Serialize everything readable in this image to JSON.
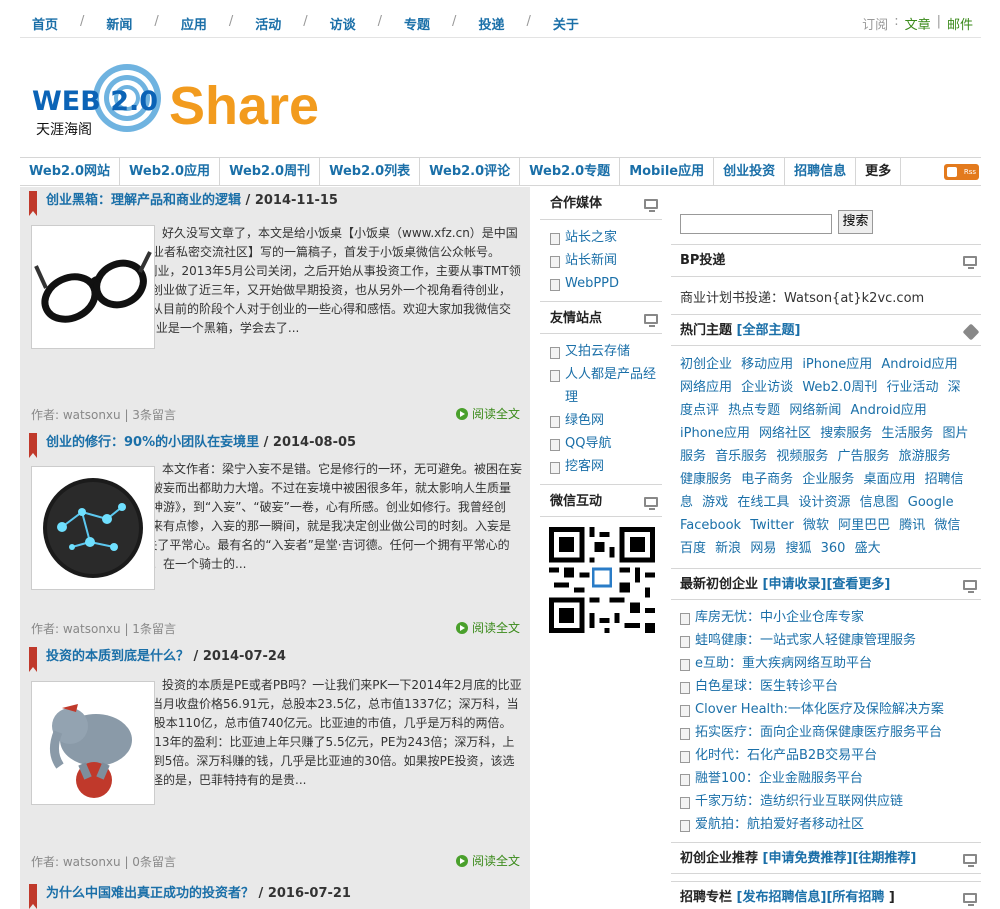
{
  "topnav": {
    "items": [
      "首页",
      "新闻",
      "应用",
      "活动",
      "访谈",
      "专题",
      "投递",
      "关于"
    ],
    "subscribe_label": "订阅",
    "article_link": "文章",
    "mail_link": "邮件"
  },
  "logo": {
    "text": "Share",
    "badge": "WEB 2.0",
    "subtext": "天涯海阁"
  },
  "mainnav": {
    "items": [
      "Web2.0网站",
      "Web2.0应用",
      "Web2.0周刊",
      "Web2.0列表",
      "Web2.0评论",
      "Web2.0专题",
      "Mobile应用",
      "创业投资",
      "招聘信息",
      "更多"
    ],
    "rss": "Rss"
  },
  "posts": [
    {
      "title": "创业黑箱：理解产品和商业的逻辑",
      "date": " / 2014-11-15",
      "body": "好久没写文章了，本文是给小饭桌【小饭桌（www.xfz.cn）是中国最具质量的TMT行业创业者私密交流社区】写的一篇稿子，首发于小饭桌微信公众帐号。 2010年底开始互联网创业，2013年5月公司关闭，之后开始从事投资工作，主要从事TMT领域早期投资，由于之前创业做了近三年，又开始做早期投资，也从另外一个视角看待创业，所以想和大家分享一些从目前的阶段个人对于创业的一些心得和感悟。欢迎大家加我微信交流：iwatsonxu 一、创业是一个黑箱，学会去了...",
      "meta": "作者: watsonxu | 3条留言",
      "more": "阅读全文"
    },
    {
      "title": "创业的修行：90%的小团队在妄境里",
      "date": " / 2014-08-05",
      "body": "本文作者：梁宁入妄不是错。它是修行的一环，无可避免。被困在妄境的长短因人而异，但破妄而出都助力大增。不过在妄境中被困很多年，就太影响人生质量了。读徐公子胜治的《神游》，到“入妄”、“破妄”一卷，心有所感。创业如修行。我曾经创业，自然曾经入妄。说来有点惨，入妄的那一瞬间，就是我决定创业做公司的时刻。入妄是什么?简单点说，就是失了平常心。最有名的“入妄者”是堂·吉诃德。任何一个拥有平常心的人，都不会做他做的事。在一个骑士的...",
      "meta": "作者: watsonxu | 1条留言",
      "more": "阅读全文"
    },
    {
      "title": "投资的本质到底是什么？",
      "date": " / 2014-07-24",
      "body": "投资的本质是PE或者PB吗？一让我们来PK一下2014年2月底的比亚迪和深万科：比亚迪，当月收盘价格56.91元，总股本23.5亿，总市值1337亿；深万科，当月收盘价格6.72元，总股本110亿，总市值740亿元。比亚迪的市值，几乎是万科的两倍。再来看看，两个公司2013年的盈利：比亚迪上年只赚了5.5亿元，PE为243倍；深万科，上年大赚151亿元，PE不到5倍。深万科赚的钱，几乎是比亚迪的30倍。如果按PE投资，该选择谁，一目了然。但奇怪的是，巴菲特持有的是贵...",
      "meta": "作者: watsonxu | 0条留言",
      "more": "阅读全文"
    },
    {
      "title": "为什么中国难出真正成功的投资者？",
      "date": " / 2016-07-21",
      "body": "",
      "meta": "",
      "more": ""
    }
  ],
  "mid": {
    "media_title": "合作媒体",
    "media": [
      "站长之家",
      "站长新闻",
      "WebPPD"
    ],
    "friends_title": "友情站点",
    "friends": [
      "又拍云存储",
      "人人都是产品经理",
      "绿色网",
      "QQ导航",
      "挖客网"
    ],
    "wechat_title": "微信互动"
  },
  "right": {
    "search_button": "搜索",
    "search_value": "",
    "bp_title": "BP投递",
    "bp_text": "商业计划书投递：Watson{at}k2vc.com",
    "tags_title": "热门主题",
    "tags_all": "[全部主题]",
    "tags": [
      "初创企业",
      "移动应用",
      "iPhone应用",
      "Android应用",
      "网络应用",
      "企业访谈",
      "Web2.0周刊",
      "行业活动",
      "深度点评",
      "热点专题",
      "网络新闻",
      "Android应用",
      "iPhone应用",
      "网络社区",
      "搜索服务",
      "生活服务",
      "图片服务",
      "音乐服务",
      "视频服务",
      "广告服务",
      "旅游服务",
      "健康服务",
      "电子商务",
      "企业服务",
      "桌面应用",
      "招聘信息",
      "游戏",
      "在线工具",
      "设计资源",
      "信息图",
      "Google",
      "Facebook",
      "Twitter",
      "微软",
      "阿里巴巴",
      "腾讯",
      "微信",
      "百度",
      "新浪",
      "网易",
      "搜狐",
      "360",
      "盛大"
    ],
    "startups_title": "最新初创企业",
    "startups_apply": "[申请收录]",
    "startups_more": "[查看更多]",
    "startups": [
      "库房无忧：中小企业仓库专家",
      "蛙鸣健康：一站式家人轻健康管理服务",
      "e互助：重大疾病网络互助平台",
      "白色星球：医生转诊平台",
      "Clover Health:一体化医疗及保险解决方案",
      "拓实医疗：面向企业商保健康医疗服务平台",
      "化时代：石化产品B2B交易平台",
      "融誉100：企业金融服务平台",
      "千家万纺：造纺织行业互联网供应链",
      "爱航拍：航拍爱好者移动社区"
    ],
    "recommend_title": "初创企业推荐",
    "recommend_apply": "[申请免费推荐]",
    "recommend_past": "[往期推荐]",
    "jobs_title": "招聘专栏",
    "jobs_post": "[发布招聘信息]",
    "jobs_all": "[所有招聘",
    "jobs_end": "]"
  }
}
